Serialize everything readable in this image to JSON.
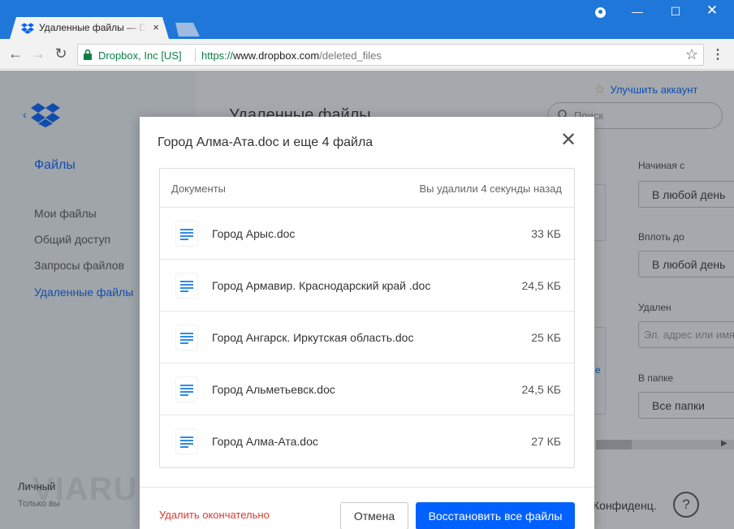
{
  "browser": {
    "tab_title": "Удаленные файлы — Dropbox",
    "tab_close": "×",
    "secure_label": "Dropbox, Inc [US]",
    "url_scheme": "https://",
    "url_host": "www.dropbox.com",
    "url_path": "/deleted_files",
    "window_min": "—",
    "window_max": "☐",
    "window_close": "✕",
    "nav_back": "←",
    "nav_forward": "→",
    "nav_reload": "↻",
    "bookmark_star": "☆",
    "menu": "⋮"
  },
  "sidebar": {
    "files": "Файлы",
    "items": [
      {
        "label": "Мои файлы",
        "active": false
      },
      {
        "label": "Общий доступ",
        "active": false
      },
      {
        "label": "Запросы файлов",
        "active": false
      },
      {
        "label": "Удаленные файлы",
        "active": true
      }
    ],
    "account": "Личный",
    "account_sub": "Только вы"
  },
  "main": {
    "title": "Удаленные файлы",
    "upgrade": "Улучшить аккаунт",
    "search_placeholder": "Поиск",
    "filters": {
      "from_label": "Начиная с",
      "from_value": "В любой день",
      "to_label": "Вплоть до",
      "to_value": "В любой день",
      "deleted_by_label": "Удален",
      "deleted_by_placeholder": "Эл. адрес или имя",
      "folder_label": "В папке",
      "folder_value": "Все папки"
    },
    "privacy": "Конфиденц.",
    "help": "?",
    "watermark": "VIARUM"
  },
  "modal": {
    "title": "Город Алма-Ата.doc и еще 4 файла",
    "close": "✕",
    "header_left": "Документы",
    "header_right": "Вы удалили 4 секунды назад",
    "files": [
      {
        "name": "Город Арыс.doc",
        "size": "33 КБ"
      },
      {
        "name": "Город Армавир. Краснодарский край .doc",
        "size": "24,5 КБ"
      },
      {
        "name": "Город Ангарск. Иркутская область.doc",
        "size": "25 КБ"
      },
      {
        "name": "Город Альметьевск.doc",
        "size": "24,5 КБ"
      },
      {
        "name": "Город Алма-Ата.doc",
        "size": "27 КБ"
      }
    ],
    "delete_permanently": "Удалить окончательно",
    "cancel": "Отмена",
    "restore_all": "Восстановить все файлы"
  },
  "colors": {
    "chrome_blue": "#1f77d9",
    "dropbox_blue": "#0061fe",
    "danger_red": "#e0372c",
    "secure_green": "#0b8043"
  }
}
